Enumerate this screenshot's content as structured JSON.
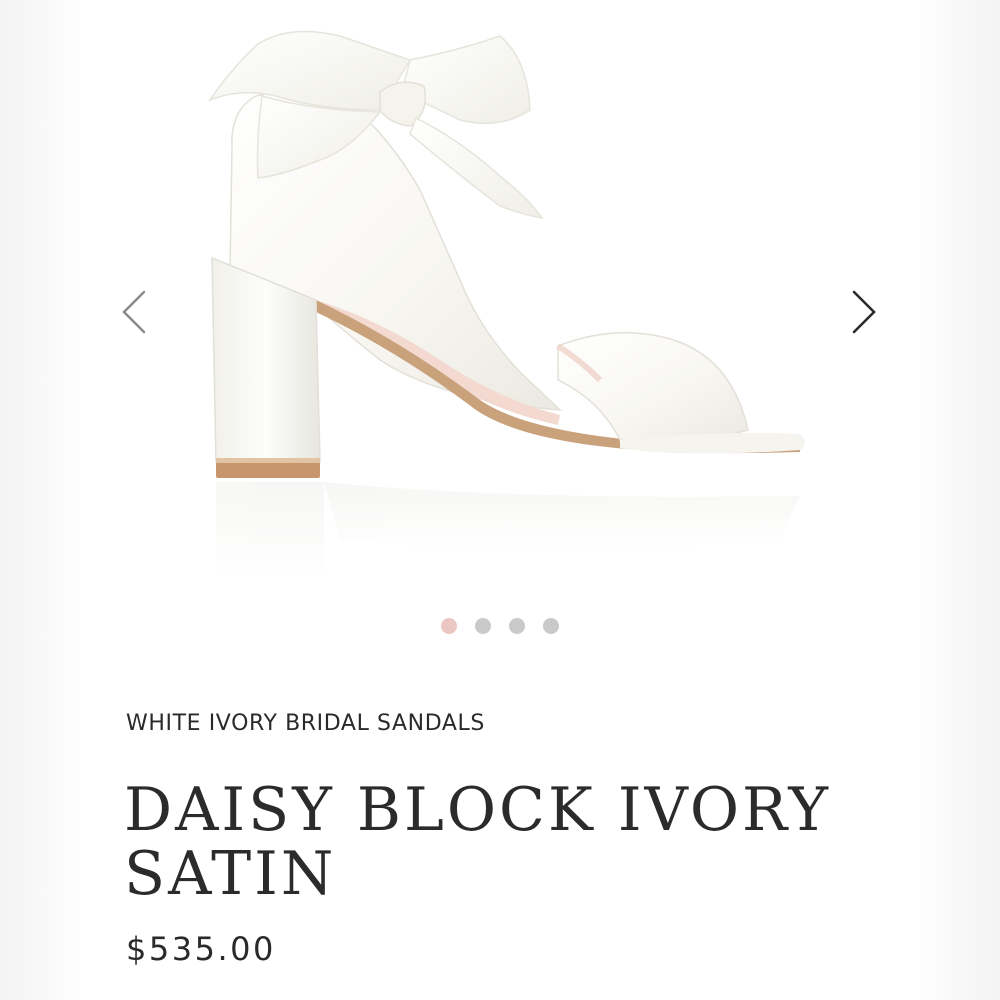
{
  "gallery": {
    "prev_icon": "chevron-left-icon",
    "next_icon": "chevron-right-icon",
    "dots_count": 4,
    "active_dot_index": 0,
    "colors": {
      "active_dot": "#ecc6c0",
      "inactive_dot": "#c9c9c9"
    }
  },
  "product": {
    "category": "WHITE IVORY BRIDAL SANDALS",
    "title": "DAISY BLOCK IVORY SATIN",
    "price": "$535.00"
  }
}
